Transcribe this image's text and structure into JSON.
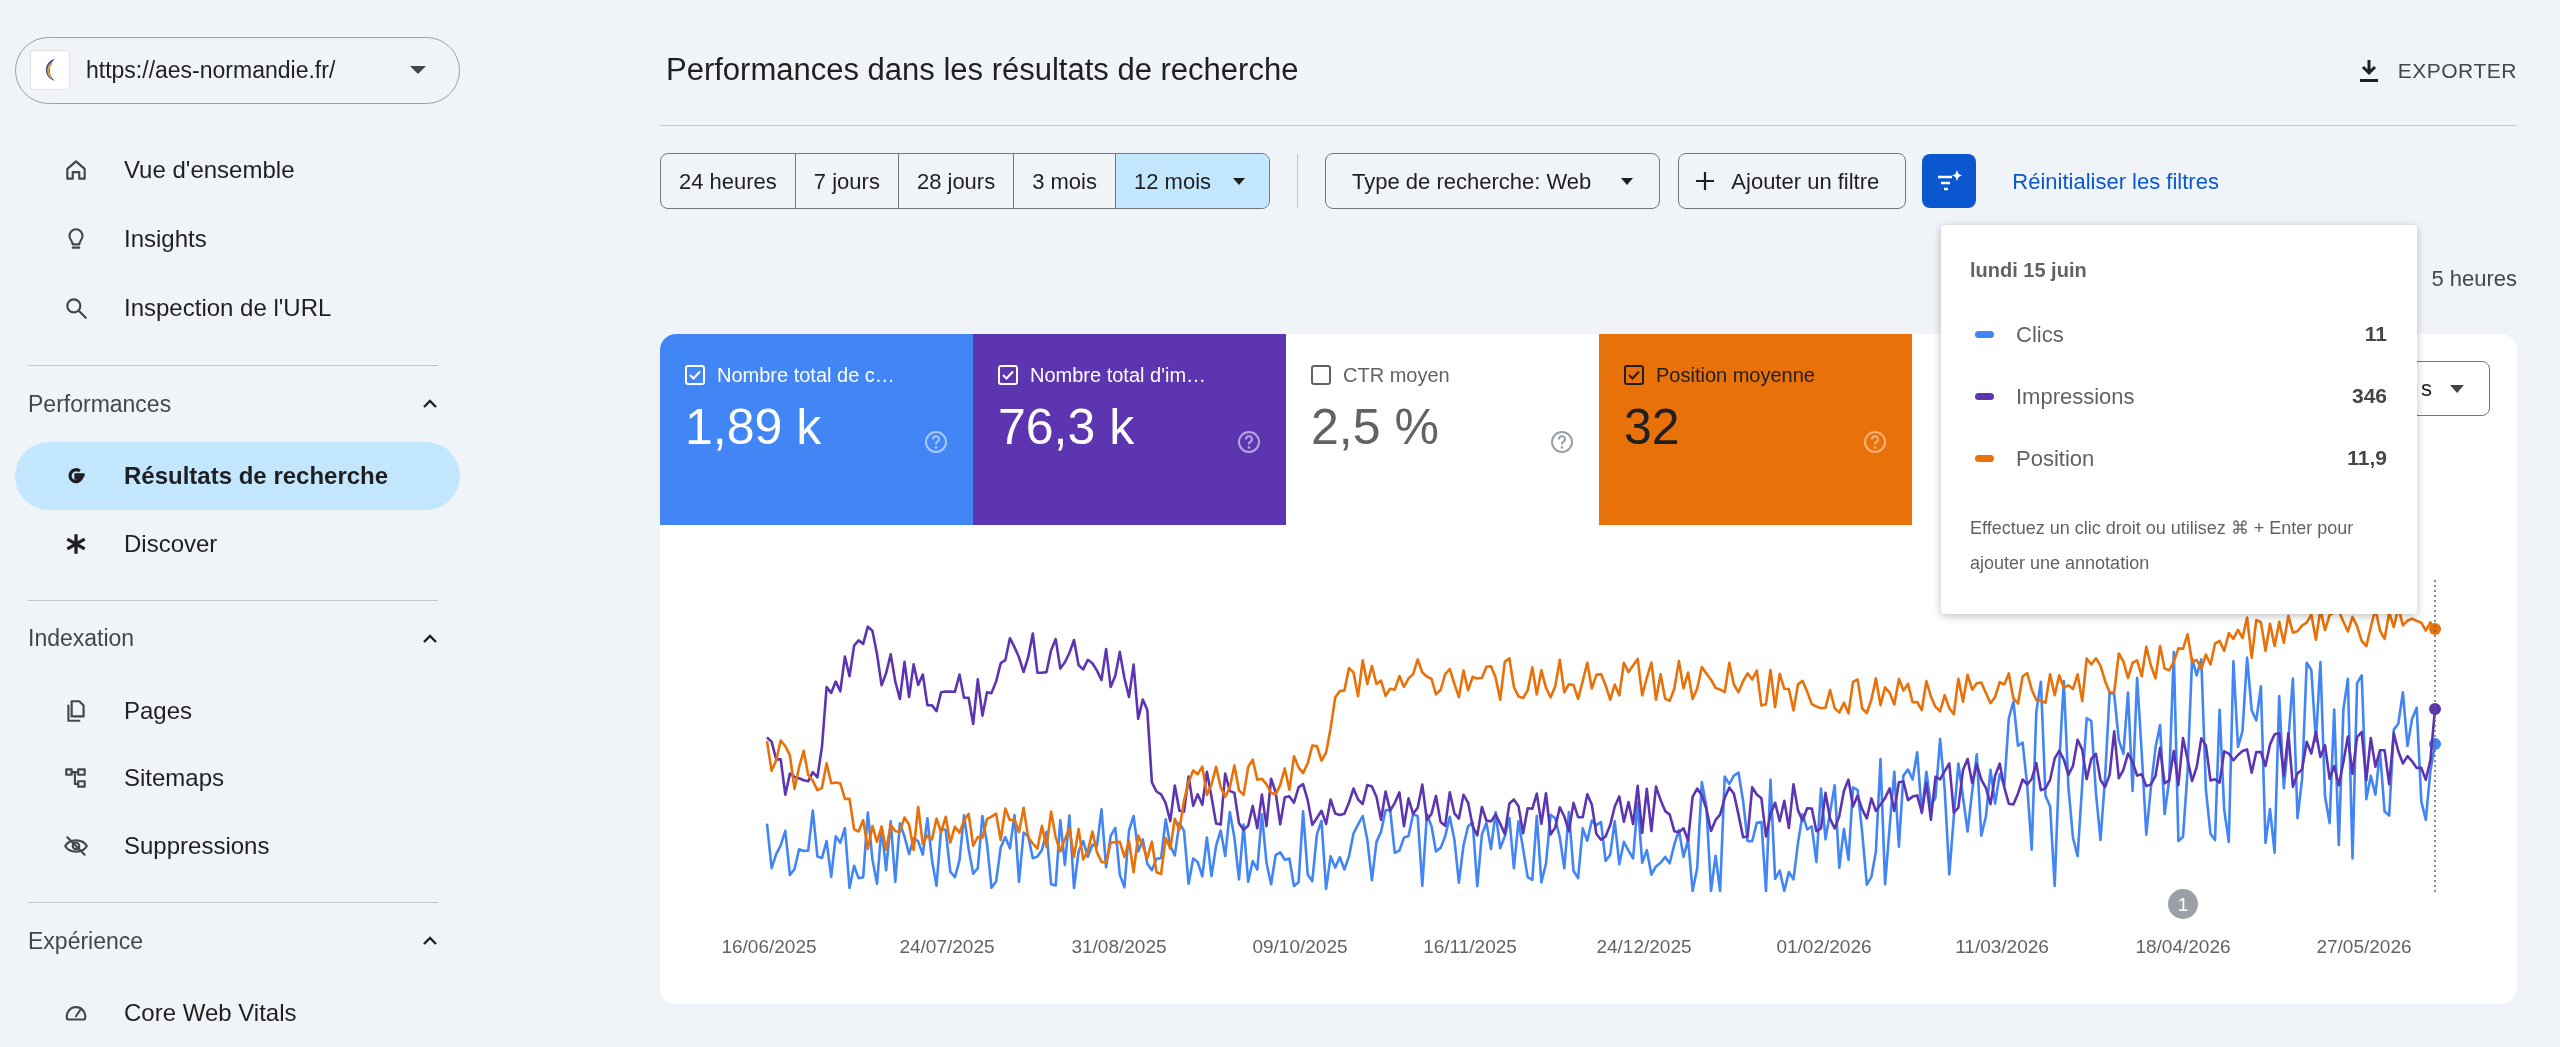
{
  "site_selector": {
    "url": "https://aes-normandie.fr/"
  },
  "nav_top": [
    {
      "label": "Vue d'ensemble",
      "selected": false
    },
    {
      "label": "Insights",
      "selected": false
    },
    {
      "label": "Inspection de l'URL",
      "selected": false
    }
  ],
  "sections": [
    {
      "title": "Performances",
      "expanded": true,
      "items": [
        {
          "label": "Résultats de recherche",
          "selected": true
        },
        {
          "label": "Discover",
          "selected": false
        }
      ]
    },
    {
      "title": "Indexation",
      "expanded": true,
      "items": [
        {
          "label": "Pages",
          "selected": false
        },
        {
          "label": "Sitemaps",
          "selected": false
        },
        {
          "label": "Suppressions",
          "selected": false
        }
      ]
    },
    {
      "title": "Expérience",
      "expanded": true,
      "items": [
        {
          "label": "Core Web Vitals",
          "selected": false
        }
      ]
    }
  ],
  "header": {
    "title": "Performances dans les résultats de recherche",
    "export_label": "EXPORTER"
  },
  "filters": {
    "ranges": [
      {
        "label": "24 heures",
        "selected": false
      },
      {
        "label": "7 jours",
        "selected": false
      },
      {
        "label": "28 jours",
        "selected": false
      },
      {
        "label": "3 mois",
        "selected": false
      },
      {
        "label": "12 mois",
        "selected": true
      }
    ],
    "search_type": "Type de recherche: Web",
    "add_filter": "Ajouter un filtre",
    "reset": "Réinitialiser les filtres"
  },
  "last_update": "5 heures",
  "metrics": [
    {
      "label": "Nombre total de c…",
      "value": "1,89 k",
      "checked": true,
      "color": "#4285f4"
    },
    {
      "label": "Nombre total d'im…",
      "value": "76,3 k",
      "checked": true,
      "color": "#5e35b1"
    },
    {
      "label": "CTR moyen",
      "value": "2,5 %",
      "checked": false
    },
    {
      "label": "Position moyenne",
      "value": "32",
      "checked": true,
      "color": "#e8710a"
    }
  ],
  "granularity_dropdown": {
    "value": "s"
  },
  "chart": {
    "x_labels": [
      "16/06/2025",
      "24/07/2025",
      "31/08/2025",
      "09/10/2025",
      "16/11/2025",
      "24/12/2025",
      "01/02/2026",
      "11/03/2026",
      "18/04/2026",
      "27/05/2026"
    ],
    "annotation": "1"
  },
  "tooltip": {
    "date": "lundi 15 juin",
    "rows": [
      {
        "label": "Clics",
        "value": "11",
        "color": "#4285f4"
      },
      {
        "label": "Impressions",
        "value": "346",
        "color": "#5e35b1"
      },
      {
        "label": "Position",
        "value": "11,9",
        "color": "#e8710a"
      }
    ],
    "hint": "Effectuez un clic droit ou utilisez ⌘ + Enter pour ajouter une annotation"
  }
}
